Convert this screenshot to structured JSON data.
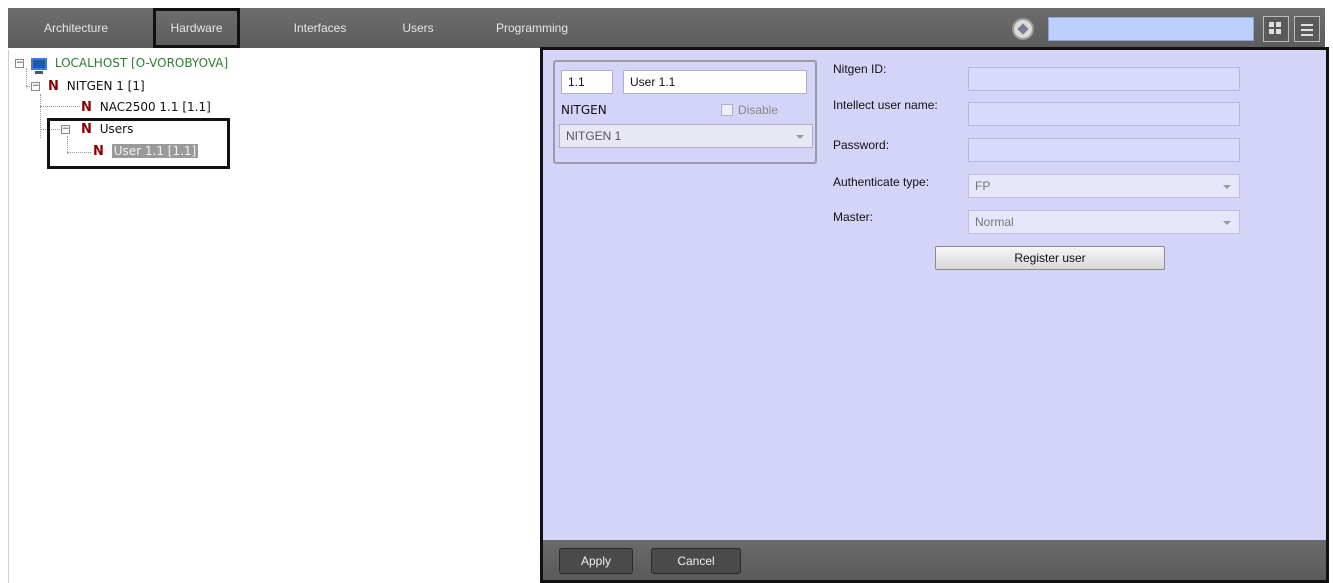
{
  "tabs": [
    {
      "label": "Architecture",
      "active": false
    },
    {
      "label": "Hardware",
      "active": true
    },
    {
      "label": "Interfaces",
      "active": false
    },
    {
      "label": "Users",
      "active": false
    },
    {
      "label": "Programming",
      "active": false
    }
  ],
  "search": {
    "value": ""
  },
  "tree": {
    "root": "LOCALHOST [O-VOROBYOVA]",
    "nitgen": "NITGEN 1 [1]",
    "nac": "NAC2500 1.1 [1.1]",
    "users": "Users",
    "user": "User 1.1 [1.1]"
  },
  "form": {
    "user_id": "1.1",
    "user_name": "User 1.1",
    "type_label": "NITGEN",
    "disable_label": "Disable",
    "parent_value": "NITGEN 1",
    "nitgen_id_label": "Nitgen ID:",
    "intellect_user_label": "Intellect user name:",
    "password_label": "Password:",
    "auth_type_label": "Authenticate type:",
    "auth_type_value": "FP",
    "master_label": "Master:",
    "master_value": "Normal",
    "register_button": "Register user",
    "apply_button": "Apply",
    "cancel_button": "Cancel"
  },
  "colors": {
    "tree_root": "#2e7d32",
    "device_icon": "#8b0000",
    "panel_bg": "#d4d4f8"
  }
}
